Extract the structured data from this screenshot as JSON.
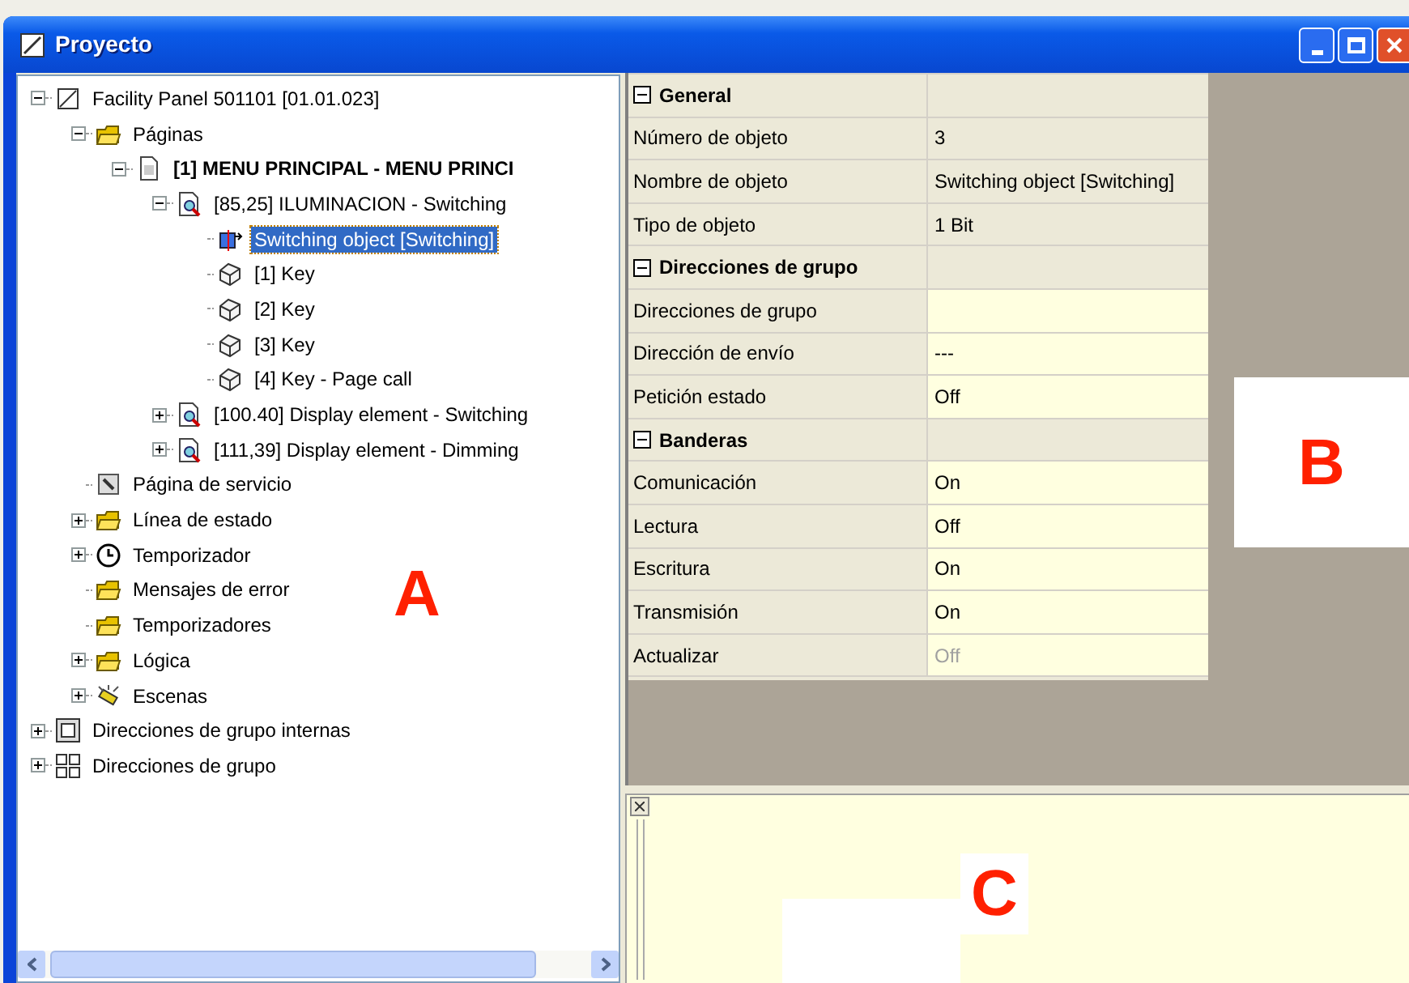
{
  "window": {
    "title": "Proyecto"
  },
  "tree": [
    {
      "label": "Facility Panel 501101 [01.01.023]",
      "kind": "panel",
      "expanded": true,
      "selected": false,
      "children": [
        {
          "label": "Páginas",
          "kind": "folder",
          "expanded": true,
          "selected": false,
          "children": [
            {
              "label": "[1] MENU PRINCIPAL - MENU PRINCI",
              "kind": "page",
              "bold": true,
              "expanded": true,
              "selected": false,
              "children": [
                {
                  "label": "[85,25] ILUMINACION - Switching",
                  "kind": "element",
                  "expanded": true,
                  "selected": false,
                  "children": [
                    {
                      "label": "Switching object [Switching]",
                      "kind": "object",
                      "selected": true
                    },
                    {
                      "label": "[1] Key",
                      "kind": "key",
                      "selected": false
                    },
                    {
                      "label": "[2] Key",
                      "kind": "key",
                      "selected": false
                    },
                    {
                      "label": "[3] Key",
                      "kind": "key",
                      "selected": false
                    },
                    {
                      "label": "[4] Key - Page call",
                      "kind": "key",
                      "selected": false
                    }
                  ]
                },
                {
                  "label": "[100.40] Display element - Switching",
                  "kind": "element",
                  "expanded": false,
                  "selected": false
                },
                {
                  "label": "[111,39] Display element - Dimming",
                  "kind": "element",
                  "expanded": false,
                  "selected": false
                }
              ]
            }
          ]
        },
        {
          "label": "Página de servicio",
          "kind": "service",
          "selected": false
        },
        {
          "label": "Línea de estado",
          "kind": "folder",
          "expanded": false,
          "selected": false
        },
        {
          "label": "Temporizador",
          "kind": "clock",
          "expanded": false,
          "selected": false
        },
        {
          "label": "Mensajes de error",
          "kind": "folder",
          "selected": false
        },
        {
          "label": "Temporizadores",
          "kind": "folder",
          "selected": false
        },
        {
          "label": "Lógica",
          "kind": "folder",
          "expanded": false,
          "selected": false
        },
        {
          "label": "Escenas",
          "kind": "scene",
          "expanded": false,
          "selected": false
        }
      ]
    },
    {
      "label": "Direcciones de grupo internas",
      "kind": "group",
      "expanded": false,
      "selected": false
    },
    {
      "label": "Direcciones de grupo",
      "kind": "groups",
      "expanded": false,
      "selected": false
    }
  ],
  "properties": [
    {
      "kind": "category",
      "label": "General",
      "expanded": true
    },
    {
      "kind": "property",
      "label": "Número de objeto",
      "value": "3",
      "editable": false,
      "disabled": false
    },
    {
      "kind": "property",
      "label": "Nombre de objeto",
      "value": "Switching object [Switching]",
      "editable": false,
      "disabled": false
    },
    {
      "kind": "property",
      "label": "Tipo de objeto",
      "value": "1 Bit",
      "editable": false,
      "disabled": false
    },
    {
      "kind": "category",
      "label": "Direcciones de grupo",
      "expanded": true
    },
    {
      "kind": "property",
      "label": "Direcciones de grupo",
      "editable": true,
      "disabled": false
    },
    {
      "kind": "property",
      "label": "Dirección de envío",
      "value": "---",
      "editable": true,
      "disabled": false
    },
    {
      "kind": "property",
      "label": "Petición estado",
      "value": "Off",
      "editable": true,
      "disabled": false
    },
    {
      "kind": "category",
      "label": "Banderas",
      "expanded": true
    },
    {
      "kind": "property",
      "label": "Comunicación",
      "value": "On",
      "editable": true,
      "disabled": false
    },
    {
      "kind": "property",
      "label": "Lectura",
      "value": "Off",
      "editable": true,
      "disabled": false
    },
    {
      "kind": "property",
      "label": "Escritura",
      "value": "On",
      "editable": true,
      "disabled": false
    },
    {
      "kind": "property",
      "label": "Transmisión",
      "value": "On",
      "editable": true,
      "disabled": false
    },
    {
      "kind": "property",
      "label": "Actualizar",
      "value": "Off",
      "editable": true,
      "disabled": true
    }
  ],
  "annotations": [
    "A",
    "B",
    "C"
  ]
}
